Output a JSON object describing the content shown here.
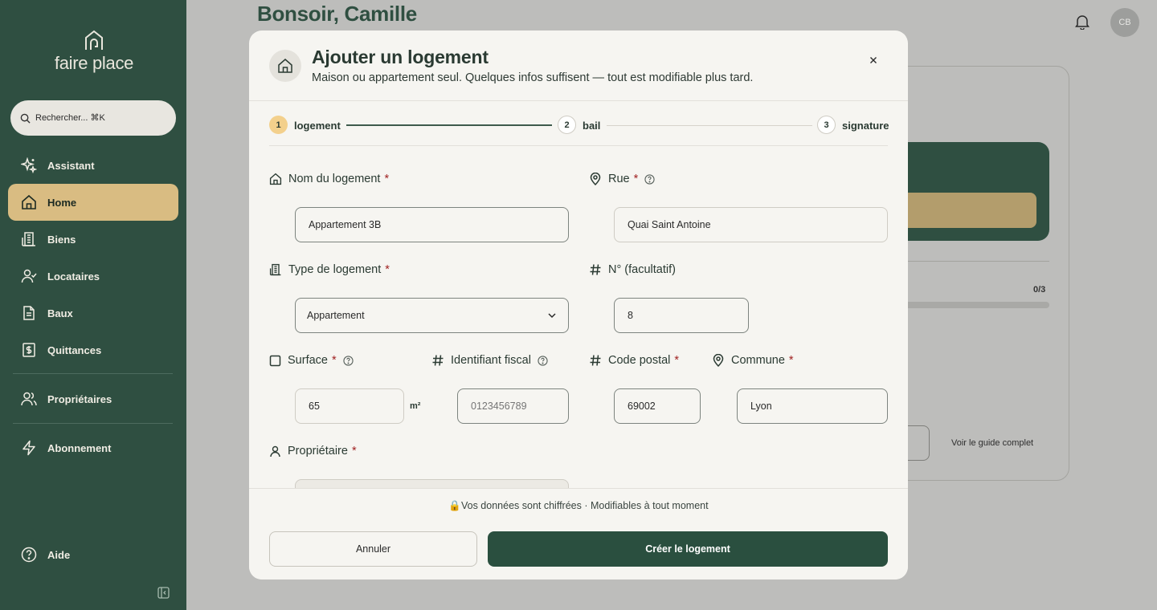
{
  "sidebar": {
    "logo_text": "faire place",
    "search_placeholder": "Rechercher... ⌘K",
    "items": [
      {
        "label": "Assistant",
        "icon": "sparkle-icon"
      },
      {
        "label": "Home",
        "icon": "home-icon",
        "active": true
      },
      {
        "label": "Biens",
        "icon": "building-icon"
      },
      {
        "label": "Locataires",
        "icon": "user-check-icon"
      },
      {
        "label": "Baux",
        "icon": "document-icon"
      },
      {
        "label": "Quittances",
        "icon": "receipt-dollar-icon"
      },
      {
        "label": "Propriétaires",
        "icon": "users-icon"
      },
      {
        "label": "Abonnement",
        "icon": "lightning-icon"
      },
      {
        "label": "Aide",
        "icon": "help-circle-icon"
      }
    ]
  },
  "header": {
    "greeting": "Bonsoir, Camille",
    "avatar_initials": "CB"
  },
  "background": {
    "progress_label": "0/3",
    "progress": 0,
    "guide_link": "Voir le guide complet"
  },
  "modal": {
    "title": "Ajouter un logement",
    "subtitle": "Maison ou appartement seul. Quelques infos suffisent — tout est modifiable plus tard.",
    "steps": [
      {
        "number": "1",
        "label": "logement",
        "active": true
      },
      {
        "number": "2",
        "label": "bail",
        "active": false
      },
      {
        "number": "3",
        "label": "signature",
        "active": false
      }
    ],
    "fields": {
      "name": {
        "label": "Nom du logement",
        "value": "Appartement 3B"
      },
      "street": {
        "label": "Rue",
        "value": "Quai Saint Antoine"
      },
      "type": {
        "label": "Type de logement",
        "value": "Appartement"
      },
      "number": {
        "label": "N° (facultatif)",
        "value": "8"
      },
      "surface": {
        "label": "Surface",
        "value": "65",
        "unit": "m²"
      },
      "fiscal_id": {
        "label": "Identifiant fiscal",
        "placeholder": "0123456789"
      },
      "postal_code": {
        "label": "Code postal",
        "value": "69002"
      },
      "city": {
        "label": "Commune",
        "value": "Lyon"
      },
      "owner": {
        "label": "Propriétaire"
      }
    },
    "required_mark": "*",
    "security_note": "🔒Vos données sont chiffrées · Modifiables à tout moment",
    "cancel_label": "Annuler",
    "create_label": "Créer le logement"
  },
  "colors": {
    "sidebar_bg": "#2f4f41",
    "accent": "#d9bc82",
    "primary_button": "#2a4f3f",
    "step_active": "#f3d08c",
    "required": "#a02222"
  }
}
